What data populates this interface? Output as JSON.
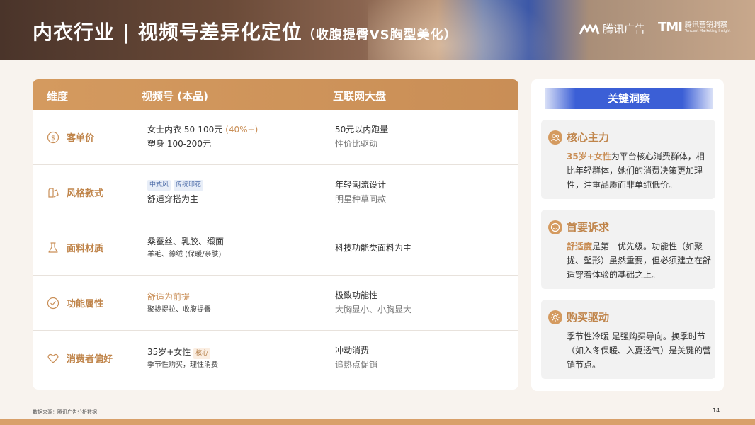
{
  "header": {
    "title": "内衣行业 | 视频号差异化定位",
    "subtitle": "（收腹提臀VS胸型美化）",
    "logo_tencent_ads": "腾讯广告",
    "logo_tmi_mark": "TMI",
    "logo_tmi_cn": "腾讯营销洞察",
    "logo_tmi_en": "Tencent Marketing Insight"
  },
  "table": {
    "headers": [
      "维度",
      "视频号 (本品)",
      "互联网大盘"
    ],
    "rows": [
      {
        "dimension": "客单价",
        "icon": "dollar-circle-icon",
        "channels_line1": "女士内衣 50-100元",
        "channels_line1_highlight": "(40%+)",
        "channels_line2": "塑身 100-200元",
        "market_line1": "50元以内跑量",
        "market_line2": "性价比驱动"
      },
      {
        "dimension": "风格款式",
        "icon": "style-icon",
        "channels_tag1": "中式风",
        "channels_tag2": "传统印花",
        "channels_line2": "舒适穿搭为主",
        "market_line1": "年轻潮流设计",
        "market_line2": "明星种草同款"
      },
      {
        "dimension": "面料材质",
        "icon": "flask-icon",
        "channels_line1": "桑蚕丝、乳胶、缎面",
        "channels_line2": "羊毛、德绒 (保暖/亲肤)",
        "market_line1": "科技功能类面料为主"
      },
      {
        "dimension": "功能属性",
        "icon": "check-circle-icon",
        "channels_line1": "舒适为前提",
        "channels_line2": "聚拢提拉、收腹提臀",
        "market_line1": "极致功能性",
        "market_line2": "大胸显小、小胸显大"
      },
      {
        "dimension": "消费者偏好",
        "icon": "heart-icon",
        "channels_line1": "35岁+女性",
        "channels_tag": "核心",
        "channels_line2": "季节性购买，理性消费",
        "market_line1": "冲动消费",
        "market_line2": "追热点促销"
      }
    ]
  },
  "insights": {
    "title": "关键洞察",
    "cards": [
      {
        "title": "核心主力",
        "icon": "users-icon",
        "highlight": "35岁+女性",
        "body": "为平台核心消费群体，相比年轻群体，她们的消费决策更加理性，注重品质而非单纯低价。"
      },
      {
        "title": "首要诉求",
        "icon": "smile-icon",
        "highlight": "舒适度",
        "body": "是第一优先级。功能性（如聚拢、塑形）虽然重要，但必须建立在舒适穿着体验的基础之上。"
      },
      {
        "title": "购买驱动",
        "icon": "sun-icon",
        "body": "季节性冷暖  是强购买导向。换季时节（如入冬保暖、入夏透气）是关键的营销节点。"
      }
    ]
  },
  "footer": {
    "source": "数据来源：腾讯广告分析数据",
    "page": "14"
  },
  "colors": {
    "accent": "#c98e56",
    "accent_dark": "#c0854b",
    "blue": "#3b5fd6",
    "background": "#f8f3ee"
  }
}
